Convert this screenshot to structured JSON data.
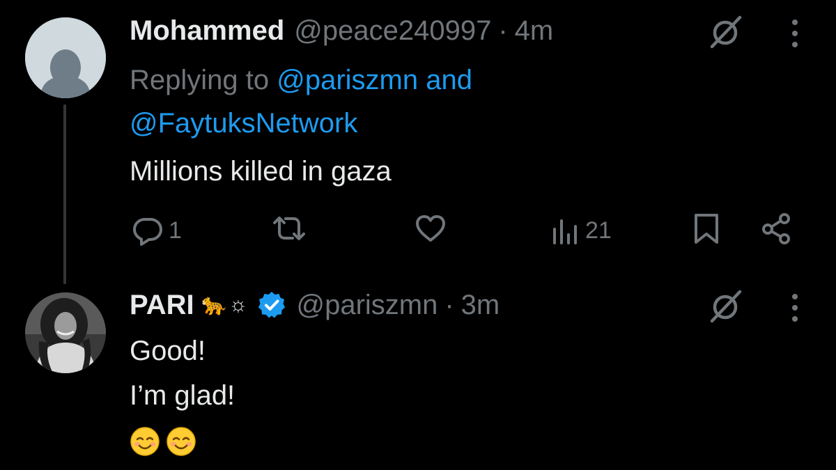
{
  "tweets": [
    {
      "display_name": "Mohammed",
      "handle": "@peace240997",
      "separator": "·",
      "time": "4m",
      "replying_prefix": "Replying to",
      "replying_user1": "@pariszmn",
      "replying_and": "and",
      "replying_user2": "@FaytuksNetwork",
      "text": "Millions killed in gaza",
      "actions": {
        "reply_count": "1",
        "repost_count": "",
        "like_count": "",
        "views_count": "21"
      },
      "avatar_icon": "default-avatar-icon"
    },
    {
      "display_name": "PARI",
      "name_emoji": "🐆☼",
      "handle": "@pariszmn",
      "separator": "·",
      "time": "3m",
      "verified": true,
      "text_line1": "Good!",
      "text_line2": "I’m glad!",
      "emojis": [
        "smiling-face-emoji",
        "smiling-face-emoji"
      ],
      "avatar_icon": "profile-photo-avatar"
    }
  ],
  "icons": {
    "reply": "reply-icon",
    "repost": "repost-icon",
    "like": "heart-icon",
    "views": "views-chart-icon",
    "bookmark": "bookmark-icon",
    "share": "share-icon",
    "grok": "grok-icon",
    "more": "more-vertical-icon"
  },
  "colors": {
    "background": "#000000",
    "text": "#e7e9ea",
    "muted": "#71767b",
    "link": "#1d9bf0",
    "thread_line": "#333639"
  }
}
